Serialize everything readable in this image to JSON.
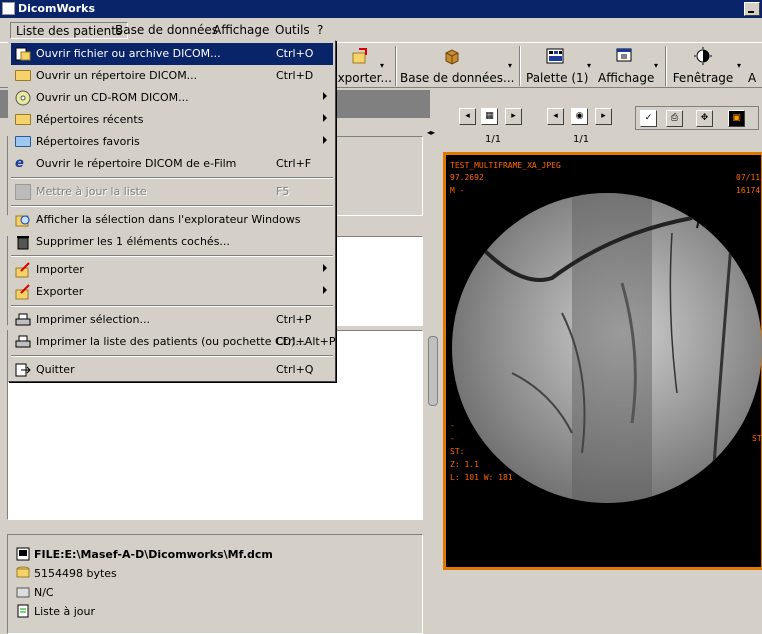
{
  "window": {
    "title": "DicomWorks"
  },
  "menubar": {
    "items": [
      "Liste des patients",
      "Base de données",
      "Affichage",
      "Outils",
      "?"
    ]
  },
  "toolbar": {
    "exporter": "Exporter...",
    "base": "Base de données...",
    "palette": "Palette (1)",
    "affichage": "Affichage",
    "fenetrage": "Fenêtrage",
    "truncated": "A"
  },
  "menu": {
    "items": [
      {
        "label": "Ouvrir fichier ou archive DICOM...",
        "shortcut": "Ctrl+O"
      },
      {
        "label": "Ouvrir un répertoire DICOM...",
        "shortcut": "Ctrl+D"
      },
      {
        "label": "Ouvrir un CD-ROM DICOM...",
        "shortcut": ""
      },
      {
        "label": "Répertoires récents",
        "shortcut": ""
      },
      {
        "label": "Répertoires favoris",
        "shortcut": ""
      },
      {
        "label": "Ouvrir le répertoire DICOM de e-Film",
        "shortcut": "Ctrl+F"
      },
      {
        "label": "Mettre à jour la liste",
        "shortcut": "F5"
      },
      {
        "label": "Afficher la sélection dans l'explorateur Windows",
        "shortcut": ""
      },
      {
        "label": "Supprimer les 1 éléments cochés...",
        "shortcut": ""
      },
      {
        "label": "Importer",
        "shortcut": ""
      },
      {
        "label": "Exporter",
        "shortcut": ""
      },
      {
        "label": "Imprimer sélection...",
        "shortcut": "Ctrl+P"
      },
      {
        "label": "Imprimer la liste des patients (ou pochette CD)...",
        "shortcut": "Ctrl+Alt+P"
      },
      {
        "label": "Quitter",
        "shortcut": "Ctrl+Q"
      }
    ]
  },
  "info": {
    "file": "FILE:E:\\Masef-A-D\\Dicomworks\\Mf.dcm",
    "size": "5154498 bytes",
    "nc": "N/C",
    "status": "Liste à jour"
  },
  "viewer": {
    "counter1": "1/1",
    "counter2": "1/1",
    "overlay": {
      "name": "TEST_MULTIFRAME_XA_JPEG",
      "value": "97.2692",
      "sex": "M -",
      "date": "07/11/",
      "time": "16174",
      "dash1": "-",
      "dash2": "-",
      "st": "ST:",
      "zoom": "Z: 1.1",
      "lw": "L: 101 W: 181",
      "right_st": "ST"
    }
  }
}
